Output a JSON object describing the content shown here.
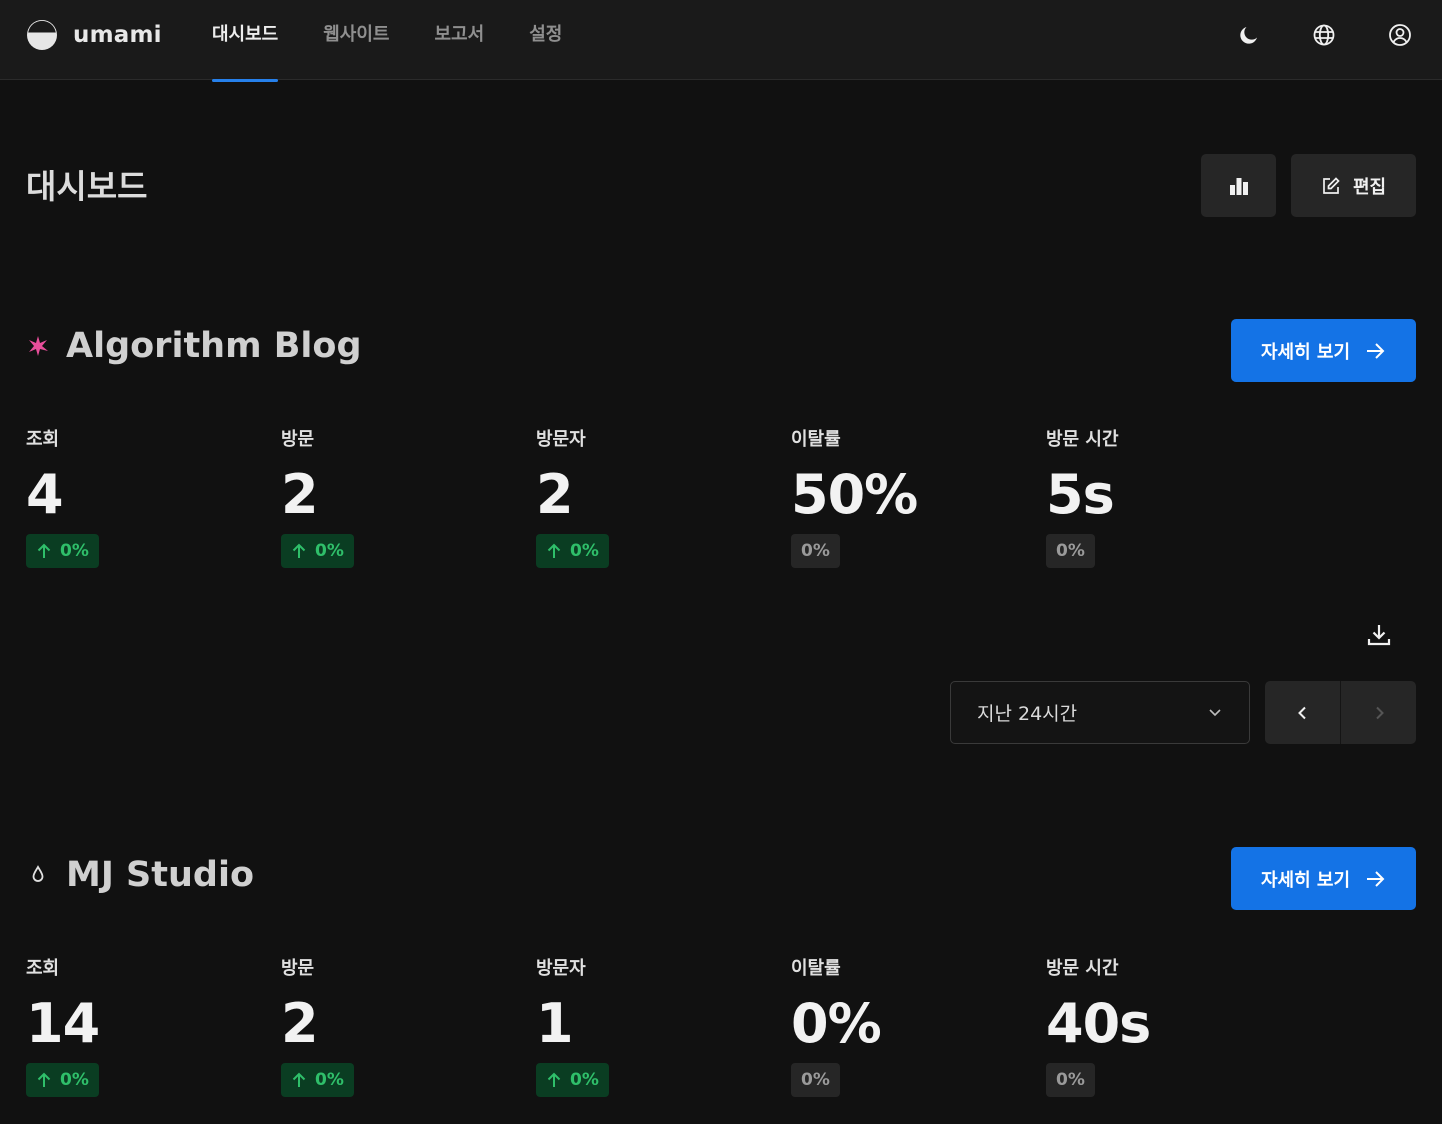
{
  "header": {
    "brand": "umami",
    "nav": [
      {
        "label": "대시보드",
        "active": true
      },
      {
        "label": "웹사이트",
        "active": false
      },
      {
        "label": "보고서",
        "active": false
      },
      {
        "label": "설정",
        "active": false
      }
    ],
    "icons": [
      "moon-icon",
      "globe-icon",
      "user-icon"
    ]
  },
  "page": {
    "title": "대시보드",
    "chart_button_icon": "bar-chart-icon",
    "edit_label": "편집"
  },
  "sites": [
    {
      "name": "Algorithm Blog",
      "favicon": "star-burst-icon",
      "view_details": "자세히 보기",
      "metrics": [
        {
          "label": "조회",
          "value": "4",
          "change": "0%",
          "trend": "up"
        },
        {
          "label": "방문",
          "value": "2",
          "change": "0%",
          "trend": "up"
        },
        {
          "label": "방문자",
          "value": "2",
          "change": "0%",
          "trend": "up"
        },
        {
          "label": "이탈률",
          "value": "50%",
          "change": "0%",
          "trend": "neutral"
        },
        {
          "label": "방문 시간",
          "value": "5s",
          "change": "0%",
          "trend": "neutral"
        }
      ]
    },
    {
      "name": "MJ Studio",
      "favicon": "drop-icon",
      "view_details": "자세히 보기",
      "metrics": [
        {
          "label": "조회",
          "value": "14",
          "change": "0%",
          "trend": "up"
        },
        {
          "label": "방문",
          "value": "2",
          "change": "0%",
          "trend": "up"
        },
        {
          "label": "방문자",
          "value": "1",
          "change": "0%",
          "trend": "up"
        },
        {
          "label": "이탈률",
          "value": "0%",
          "change": "0%",
          "trend": "neutral"
        },
        {
          "label": "방문 시간",
          "value": "40s",
          "change": "0%",
          "trend": "neutral"
        }
      ]
    }
  ],
  "filters": {
    "date_range": "지난 24시간"
  },
  "colors": {
    "accent": "#1473e6",
    "up_bg": "#0a3d22",
    "up_fg": "#2fbf6a"
  }
}
